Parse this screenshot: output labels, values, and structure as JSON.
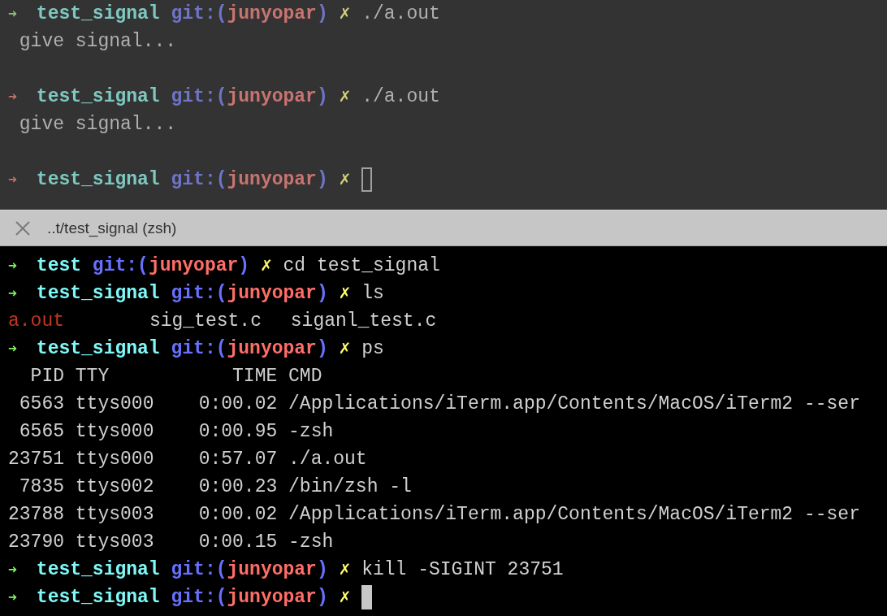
{
  "panes": [
    {
      "active": false,
      "lines": [
        {
          "kind": "prompt",
          "color": "#8fc07a",
          "arrow": "➜",
          "dir": "test_signal",
          "git_open": "git:(",
          "branch": "junyopar",
          "git_close": ")",
          "dirty": "✗",
          "command": "./a.out"
        },
        {
          "kind": "output",
          "text": " give signal..."
        },
        {
          "kind": "blank"
        },
        {
          "kind": "prompt",
          "color": "#c0736b",
          "arrow": "➜",
          "dir": "test_signal",
          "git_open": "git:(",
          "branch": "junyopar",
          "git_close": ")",
          "dirty": "✗",
          "command": "./a.out"
        },
        {
          "kind": "output",
          "text": " give signal..."
        },
        {
          "kind": "blank"
        },
        {
          "kind": "prompt",
          "color": "#c0736b",
          "arrow": "➜",
          "dir": "test_signal",
          "git_open": "git:(",
          "branch": "junyopar",
          "git_close": ")",
          "dirty": "✗",
          "cursor": true
        }
      ]
    },
    {
      "active": true,
      "title": "..t/test_signal (zsh)",
      "lines": [
        {
          "kind": "prompt",
          "color": "#7ef561",
          "arrow": "➜",
          "dir": "test",
          "git_open": "git:(",
          "branch": "junyopar",
          "git_close": ")",
          "dirty": "✗",
          "command": "cd test_signal"
        },
        {
          "kind": "prompt",
          "color": "#7ef561",
          "arrow": "➜",
          "dir": "test_signal",
          "git_open": "git:(",
          "branch": "junyopar",
          "git_close": ")",
          "dirty": "✗",
          "command": "ls"
        },
        {
          "kind": "listing",
          "files": [
            {
              "name": "a.out",
              "color": "#c23621"
            },
            {
              "name": "sig_test.c",
              "color": "#d0d0d0"
            },
            {
              "name": "siganl_test.c",
              "color": "#d0d0d0"
            }
          ]
        },
        {
          "kind": "prompt",
          "color": "#7ef561",
          "arrow": "➜",
          "dir": "test_signal",
          "git_open": "git:(",
          "branch": "junyopar",
          "git_close": ")",
          "dirty": "✗",
          "command": "ps"
        },
        {
          "kind": "output",
          "text": "  PID TTY           TIME CMD"
        },
        {
          "kind": "output",
          "text": " 6563 ttys000    0:00.02 /Applications/iTerm.app/Contents/MacOS/iTerm2 --ser"
        },
        {
          "kind": "output",
          "text": " 6565 ttys000    0:00.95 -zsh"
        },
        {
          "kind": "output",
          "text": "23751 ttys000    0:57.07 ./a.out"
        },
        {
          "kind": "output",
          "text": " 7835 ttys002    0:00.23 /bin/zsh -l"
        },
        {
          "kind": "output",
          "text": "23788 ttys003    0:00.02 /Applications/iTerm.app/Contents/MacOS/iTerm2 --ser"
        },
        {
          "kind": "output",
          "text": "23790 ttys003    0:00.15 -zsh"
        },
        {
          "kind": "prompt",
          "color": "#7ef561",
          "arrow": "➜",
          "dir": "test_signal",
          "git_open": "git:(",
          "branch": "junyopar",
          "git_close": ")",
          "dirty": "✗",
          "command": "kill -SIGINT 23751"
        },
        {
          "kind": "prompt",
          "color": "#7ef561",
          "arrow": "➜",
          "dir": "test_signal",
          "git_open": "git:(",
          "branch": "junyopar",
          "git_close": ")",
          "dirty": "✗",
          "cursor": true
        }
      ]
    }
  ]
}
